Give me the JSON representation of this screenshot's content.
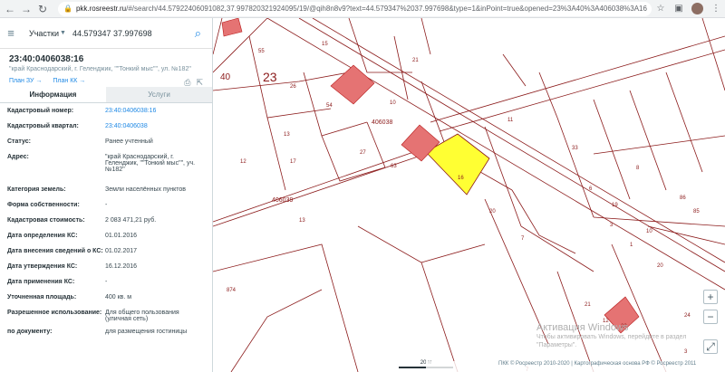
{
  "browser": {
    "host": "pkk.rosreestr.ru",
    "url_path": "/#/search/44.57922406091082,37.99782032192409​5/19/@qih8n8v9?text=44.579347%2037.997698&type=1&inPoint=true&opened=23%3A40%3A406038%3A16"
  },
  "search": {
    "type_label": "Участки",
    "query": "44.579347 37.997698"
  },
  "object": {
    "number": "23:40:0406038:16",
    "address": "\"край Краснодарский, г. Геленджик, \"\"Тонкий мыс\"\", ул. №182\""
  },
  "links": {
    "plan_zu": "План ЗУ →",
    "plan_kk": "План КК →"
  },
  "tabs": {
    "info": "Информация",
    "services": "Услуги"
  },
  "rows": [
    {
      "k": "Кадастровый номер:",
      "v": "23:40:0406038:16",
      "link": true
    },
    {
      "k": "Кадастровый квартал:",
      "v": "23:40:0406038",
      "link": true
    },
    {
      "k": "Статус:",
      "v": "Ранее учтенный",
      "link": false
    },
    {
      "k": "Адрес:",
      "v": "\"край Краснодарский, г. Геленджик, \"\"Тонкий мыс\"\", уч. №182\"",
      "link": false
    },
    {
      "k": "Категория земель:",
      "v": "Земли населённых пунктов",
      "link": false
    },
    {
      "k": "Форма собственности:",
      "v": "-",
      "link": false
    },
    {
      "k": "Кадастровая стоимость:",
      "v": "2 083 471,21 руб.",
      "link": false
    },
    {
      "k": "Дата определения КС:",
      "v": "01.01.2016",
      "link": false
    },
    {
      "k": "Дата внесения сведений о КС:",
      "v": "01.02.2017",
      "link": false
    },
    {
      "k": "Дата утверждения КС:",
      "v": "16.12.2016",
      "link": false
    },
    {
      "k": "Дата применения КС:",
      "v": "-",
      "link": false
    },
    {
      "k": "Уточненная площадь:",
      "v": "400 кв. м",
      "link": false
    },
    {
      "k": "Разрешенное использование:",
      "v": "Для общего пользования (уличная сеть)",
      "link": false
    },
    {
      "k": "по документу:",
      "v": "для размещения гостиницы",
      "link": false
    }
  ],
  "map": {
    "labels": {
      "district": "23",
      "district2": "40",
      "quarter1": "406038",
      "quarter2": "406039",
      "parcels": [
        "55",
        "15",
        "21",
        "26",
        "10",
        "54",
        "13",
        "17",
        "11",
        "33",
        "8",
        "27",
        "16",
        "12",
        "63",
        "20",
        "13",
        "7",
        "6",
        "19",
        "86",
        "85",
        "10",
        "3",
        "1",
        "874",
        "20",
        "24",
        "21",
        "22",
        "12",
        "3",
        "7"
      ]
    },
    "selected_color": "#ffff33",
    "building_color": "#e57373",
    "line_color": "#8b1a1a"
  },
  "watermark": {
    "title": "Активация Windows",
    "line1": "Чтобы активировать Windows, перейдите в раздел",
    "line2": "\"Параметры\"."
  },
  "footer": {
    "scale": "20 м",
    "copyright": "ПКК © Росреестр 2010-2020 | Картографическая основа РФ © Росреестр 2011"
  }
}
